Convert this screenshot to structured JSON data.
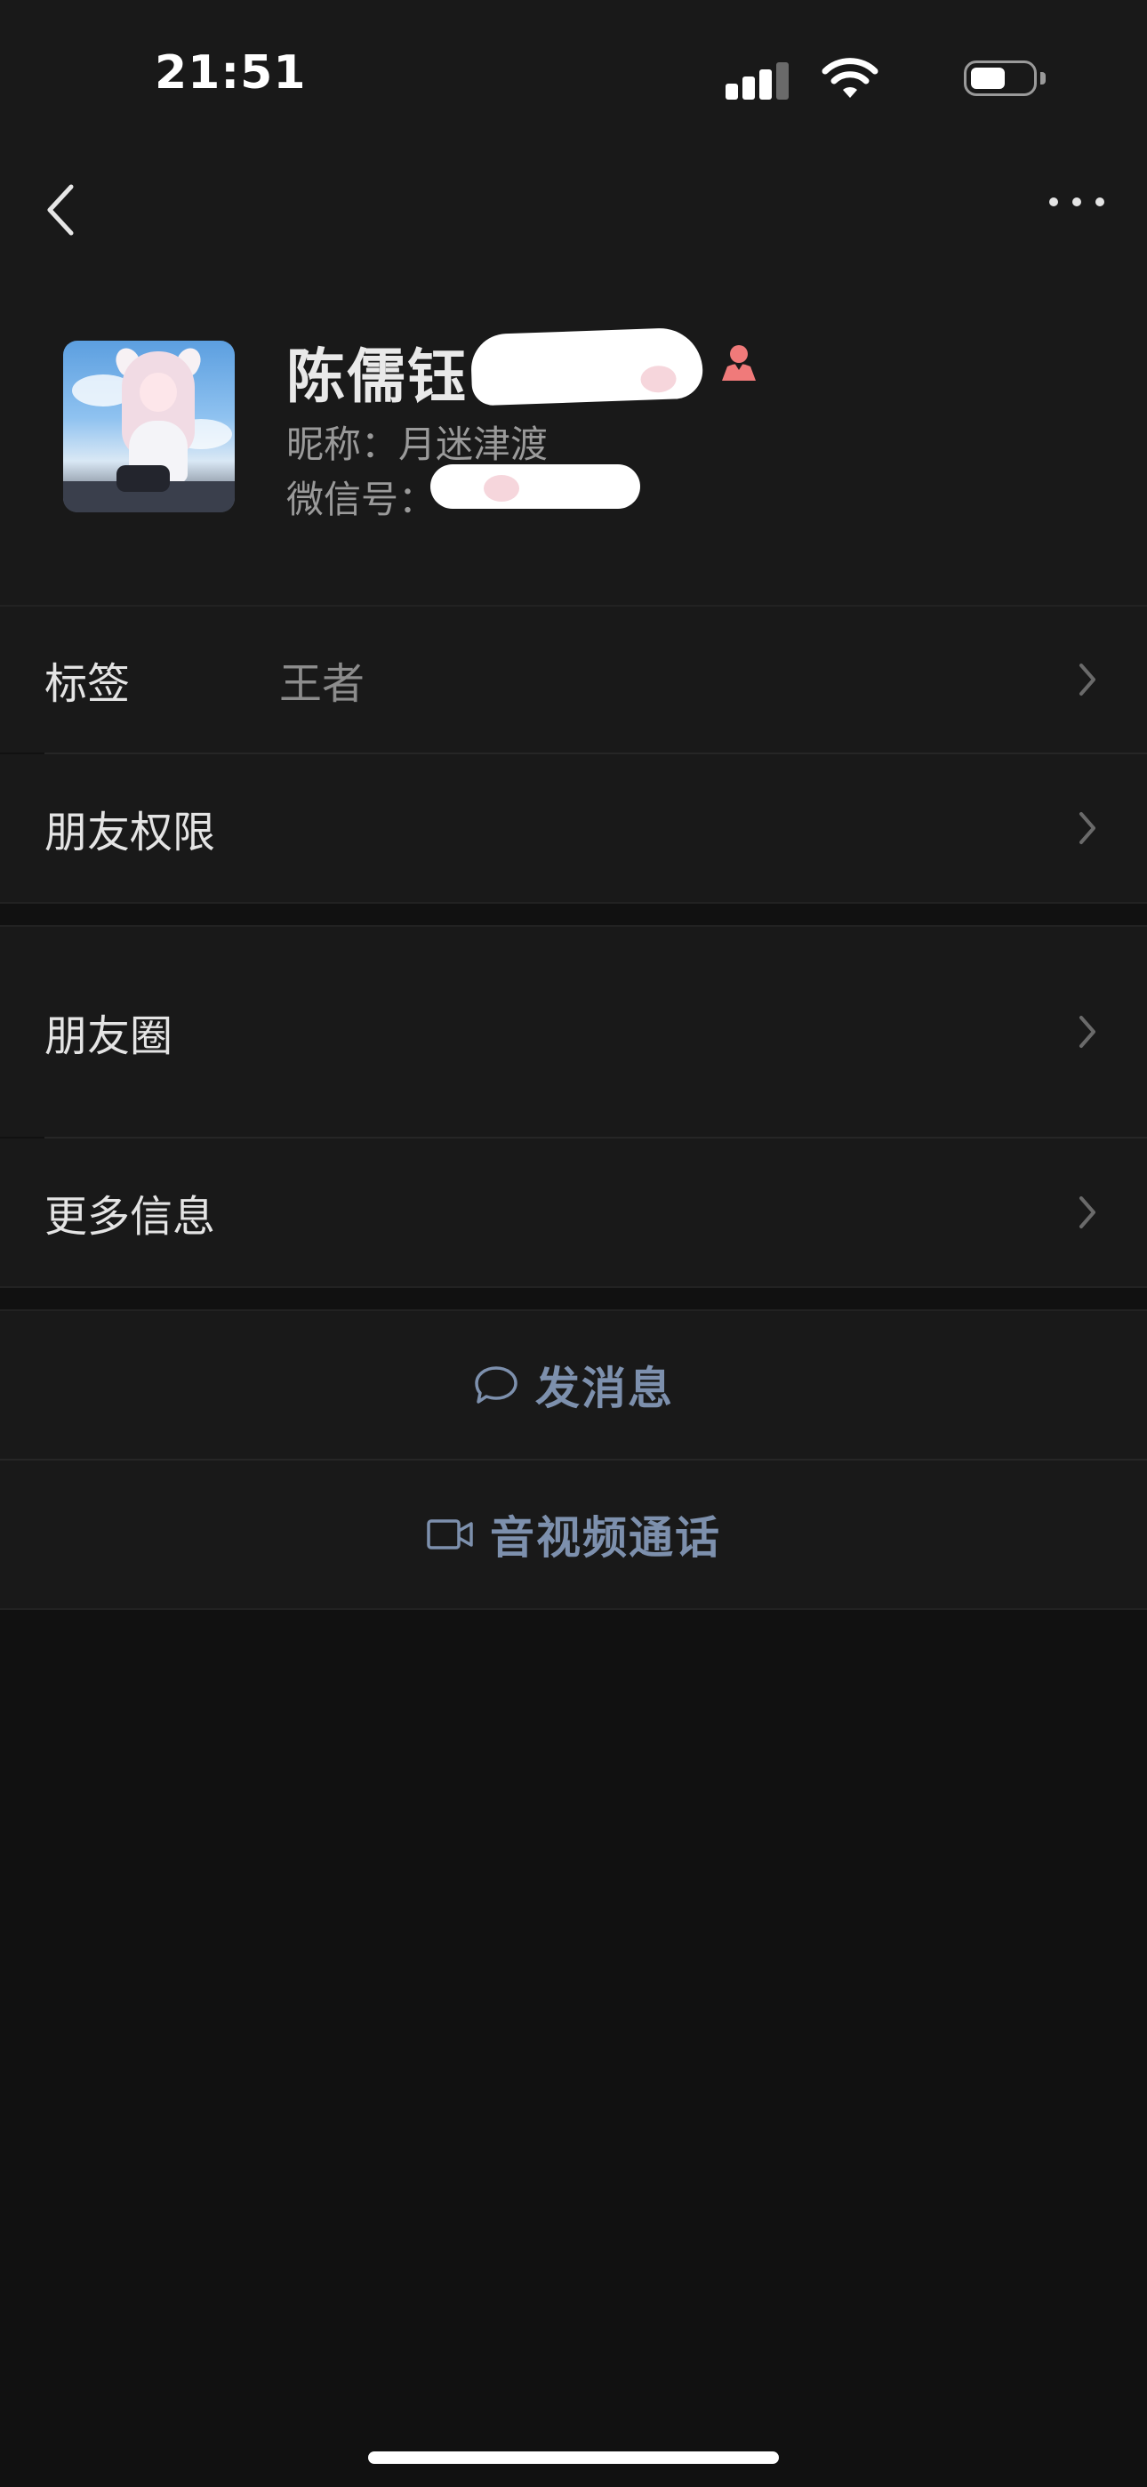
{
  "status_bar": {
    "time": "21:51",
    "icons": [
      "cellular-signal-icon",
      "wifi-icon",
      "battery-icon"
    ]
  },
  "nav": {
    "back_icon": "chevron-left-icon",
    "more_icon": "more-dots-icon"
  },
  "profile": {
    "name": "陈儒钰",
    "gender_icon": "female-icon",
    "nickname": "昵称：月迷津渡",
    "wechat_id": "微信号：",
    "avatar": "anime-girl-avatar"
  },
  "rows": {
    "tags": {
      "label": "标签",
      "value": "王者"
    },
    "friend_permissions": {
      "label": "朋友权限"
    },
    "moments": {
      "label": "朋友圈"
    },
    "more_info": {
      "label": "更多信息"
    }
  },
  "actions": {
    "send_message": {
      "label": "发消息",
      "icon": "chat-bubble-icon"
    },
    "av_call": {
      "label": "音视频通话",
      "icon": "video-camera-icon"
    }
  },
  "colors": {
    "background": "#111111",
    "surface": "#191919",
    "action_text": "#7d90ad",
    "gender_icon": "#f07a7a"
  }
}
